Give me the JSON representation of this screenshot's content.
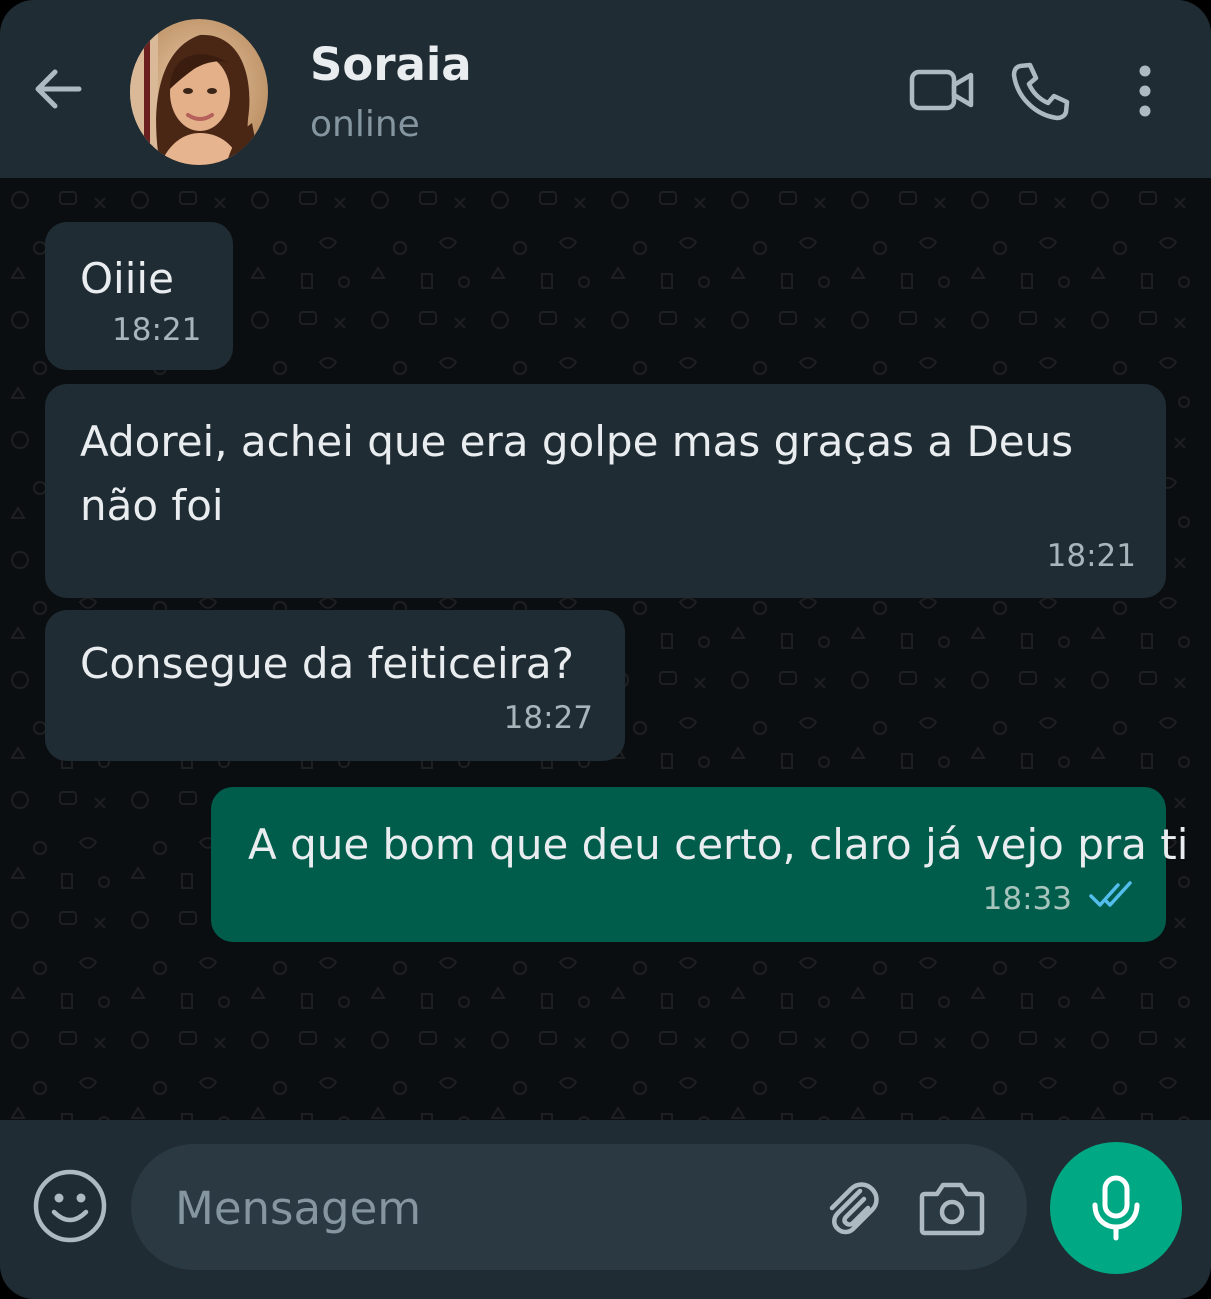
{
  "header": {
    "contact_name": "Soraia",
    "contact_status": "online"
  },
  "icons": {
    "back": "arrow-left-icon",
    "video": "video-camera-icon",
    "call": "phone-icon",
    "menu": "more-vertical-icon",
    "emoji": "emoji-smile-icon",
    "attach": "paperclip-icon",
    "camera": "camera-icon",
    "mic": "microphone-icon",
    "read": "double-check-icon"
  },
  "messages": [
    {
      "direction": "in",
      "text": "Oiiie",
      "time": "18:21"
    },
    {
      "direction": "in",
      "text": "Adorei, achei que era golpe mas graças a Deus não foi",
      "time": "18:21"
    },
    {
      "direction": "in",
      "text": "Consegue da feiticeira?",
      "time": "18:27"
    },
    {
      "direction": "out",
      "text": "A que bom que deu certo, claro já vejo pra ti",
      "time": "18:33",
      "status": "read"
    }
  ],
  "composer": {
    "placeholder": "Mensagem"
  },
  "colors": {
    "header_bg": "#1f2c34",
    "chat_bg": "#0b0e10",
    "incoming_bubble": "#1f2c34",
    "outgoing_bubble": "#005c4b",
    "accent": "#00a884",
    "read_ticks": "#53bdeb"
  }
}
